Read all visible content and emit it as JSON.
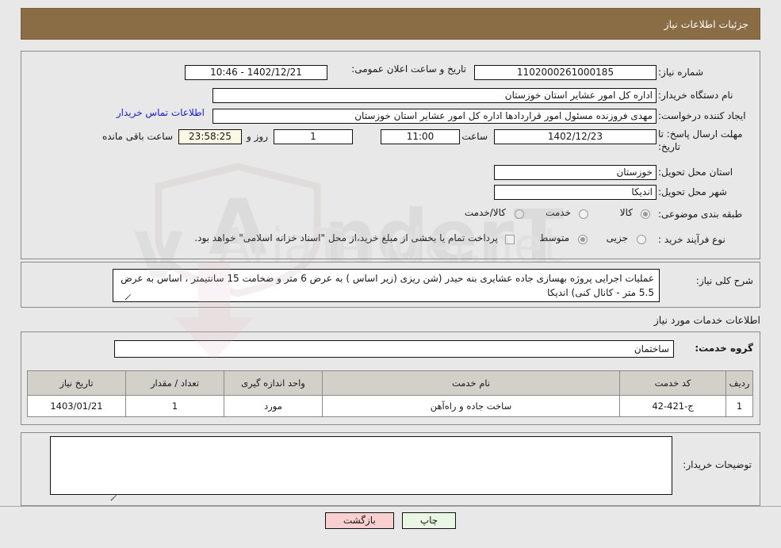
{
  "header": {
    "title": "جزئیات اطلاعات نیاز"
  },
  "top_form": {
    "need_number_label": "شماره نیاز:",
    "need_number_value": "1102000261000185",
    "announce_label": "تاریخ و ساعت اعلان عمومی:",
    "announce_value": "1402/12/21 - 10:46",
    "buyer_org_label": "نام دستگاه خریدار:",
    "buyer_org_value": "اداره کل امور عشایر استان خوزستان",
    "requester_label": "ایجاد کننده درخواست:",
    "requester_value": "مهدی فروزنده مسئول امور قراردادها اداره کل امور عشایر استان خوزستان",
    "contact_link": "اطلاعات تماس خریدار",
    "deadline_label": "مهلت ارسال پاسخ: تا تاریخ:",
    "deadline_date": "1402/12/23",
    "hour_label": "ساعت",
    "deadline_time": "11:00",
    "days_value": "1",
    "days_suffix": "روز و",
    "countdown_value": "23:58:25",
    "countdown_suffix": "ساعت باقی مانده",
    "province_label": "استان محل تحویل:",
    "province_value": "خوزستان",
    "city_label": "شهر محل تحویل:",
    "city_value": "اندیکا",
    "category_label": "طبقه بندی موضوعی:",
    "category_options": [
      {
        "label": "کالا",
        "selected": true
      },
      {
        "label": "خدمت",
        "selected": false
      },
      {
        "label": "کالا/خدمت",
        "selected": false
      }
    ],
    "process_label": "نوع فرآیند خرید :",
    "process_options": [
      {
        "label": "جزیی",
        "selected": false
      },
      {
        "label": "متوسط",
        "selected": true
      }
    ],
    "treasury_checkbox_text": "پرداخت تمام یا بخشی از مبلغ خرید،از محل \"اسناد خزانه اسلامی\" خواهد بود.",
    "treasury_checked": false
  },
  "description": {
    "label": "شرح کلی نیاز:",
    "value": "عملیات اجرایی پروژه بهسازی جاده عشایری بنه حیدر (شن ریزی (زیر اساس ) به عرض 6 متر و ضخامت 15 سانتیمتر ، اساس به عرض 5.5 متر - کانال کنی) اندیکا"
  },
  "services": {
    "section_title": "اطلاعات خدمات مورد نیاز",
    "group_label": "گروه خدمت:",
    "group_value": "ساختمان",
    "columns": [
      "ردیف",
      "کد خدمت",
      "نام خدمت",
      "واحد اندازه گیری",
      "تعداد / مقدار",
      "تاریخ نیاز"
    ],
    "rows": [
      {
        "index": "1",
        "code": "ج-421-42",
        "name": "ساخت جاده و راه‌آهن",
        "unit": "مورد",
        "quantity": "1",
        "need_date": "1403/01/21"
      }
    ]
  },
  "notes": {
    "label": "توضیحات خریدار:",
    "value": ""
  },
  "footer": {
    "print_label": "چاپ",
    "back_label": "بازگشت"
  },
  "watermark": {
    "text": "AriaTender.net"
  },
  "colors": {
    "header_bg": "#8a6c45",
    "page_bg": "#e8e8e8",
    "link": "#1420d8",
    "table_header_bg": "#d3cfc9",
    "service_name": "#6a5a1e",
    "print_btn_bg": "#e9f6e4",
    "back_btn_bg": "#f9cfcf",
    "timer_bg": "#fbf8e3"
  }
}
